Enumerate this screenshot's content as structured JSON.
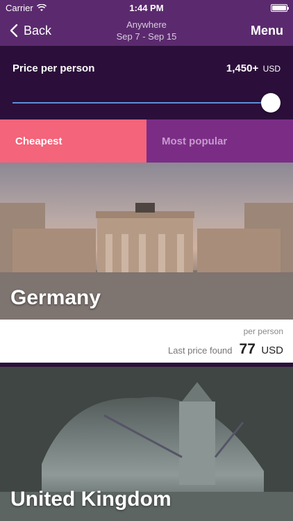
{
  "status": {
    "carrier": "Carrier",
    "time": "1:44 PM",
    "battery_level": 1.0
  },
  "nav": {
    "back_label": "Back",
    "title": "Anywhere",
    "dates": "Sep 7 - Sep 15",
    "menu_label": "Menu"
  },
  "price_filter": {
    "label": "Price per person",
    "value": "1,450+",
    "unit": "USD",
    "slider_fraction": 1.0
  },
  "tabs": [
    {
      "label": "Cheapest",
      "active": true
    },
    {
      "label": "Most popular",
      "active": false
    }
  ],
  "destinations": [
    {
      "name": "Germany",
      "per_person_label": "per person",
      "last_price_label": "Last price found",
      "price": "77",
      "currency": "USD"
    },
    {
      "name": "United Kingdom"
    }
  ],
  "colors": {
    "nav": "#5b2a6e",
    "dark": "#2b0f3a",
    "tab_active": "#f4647a",
    "tab_inactive": "#7b2d86",
    "slider": "#5f8fd9"
  }
}
